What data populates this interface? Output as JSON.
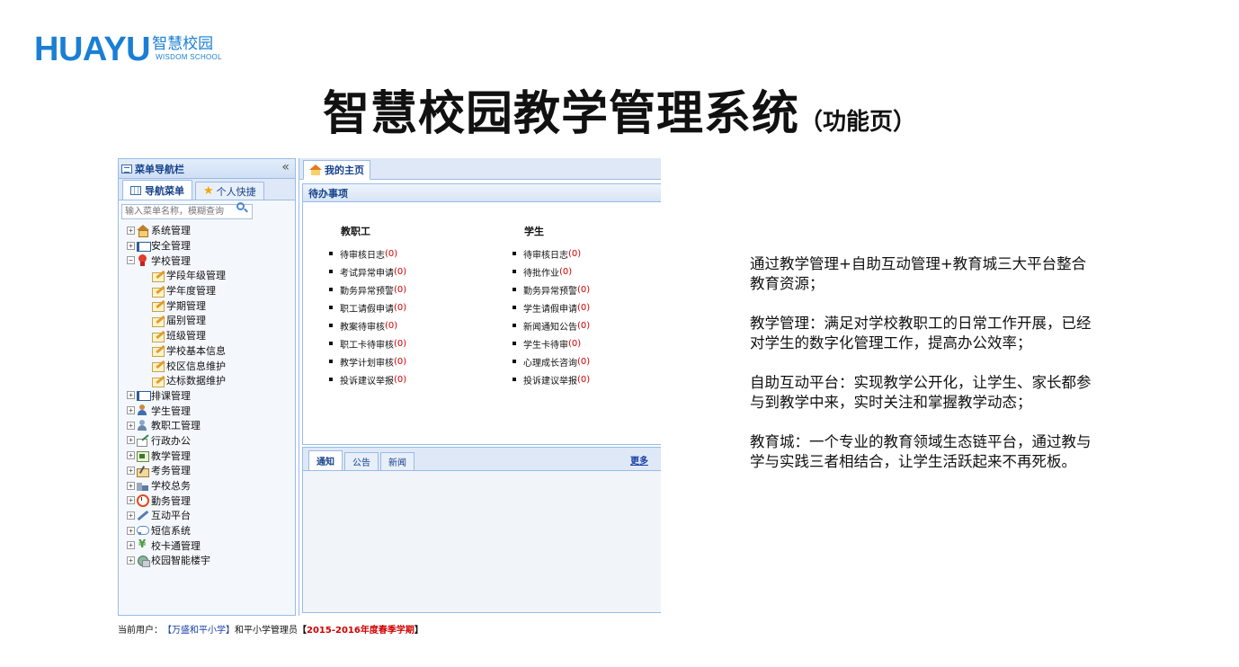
{
  "logo": {
    "word": "HUAYU",
    "cn": "智慧校园",
    "en": "WISDOM SCHOOL"
  },
  "title": {
    "main": "智慧校园教学管理系统",
    "sub": "（功能页）"
  },
  "app": {
    "sidebar": {
      "title": "菜单导航栏",
      "collapse_glyph": "«",
      "tabs": [
        "导航菜单",
        "个人快捷"
      ],
      "search_placeholder": "输入菜单名称，模糊查询",
      "tree": [
        {
          "label": "系统管理",
          "icon": "house-icon",
          "toggle": "+"
        },
        {
          "label": "安全管理",
          "icon": "book-icon",
          "toggle": "+"
        },
        {
          "label": "学校管理",
          "icon": "medal-icon",
          "toggle": "−"
        },
        {
          "label": "学段年级管理",
          "icon": "pencil-icon",
          "child": true
        },
        {
          "label": "学年度管理",
          "icon": "pencil-icon",
          "child": true
        },
        {
          "label": "学期管理",
          "icon": "pencil-icon",
          "child": true
        },
        {
          "label": "届别管理",
          "icon": "pencil-icon",
          "child": true
        },
        {
          "label": "班级管理",
          "icon": "pencil-icon",
          "child": true
        },
        {
          "label": "学校基本信息",
          "icon": "pencil-icon",
          "child": true
        },
        {
          "label": "校区信息维护",
          "icon": "pencil-icon",
          "child": true
        },
        {
          "label": "达标数据维护",
          "icon": "pencil-icon",
          "child": true
        },
        {
          "label": "排课管理",
          "icon": "book-icon",
          "toggle": "+"
        },
        {
          "label": "学生管理",
          "icon": "person-icon",
          "toggle": "+"
        },
        {
          "label": "教职工管理",
          "icon": "staff-icon",
          "toggle": "+"
        },
        {
          "label": "行政办公",
          "icon": "office-icon",
          "toggle": "+"
        },
        {
          "label": "教学管理",
          "icon": "teach-icon",
          "toggle": "+"
        },
        {
          "label": "考务管理",
          "icon": "exam-icon",
          "toggle": "+"
        },
        {
          "label": "学校总务",
          "icon": "bldg-icon",
          "toggle": "+"
        },
        {
          "label": "勤务管理",
          "icon": "clock-icon",
          "toggle": "+"
        },
        {
          "label": "互动平台",
          "icon": "pen-icon",
          "toggle": "+"
        },
        {
          "label": "短信系统",
          "icon": "bubble-icon",
          "toggle": "+"
        },
        {
          "label": "校卡通管理",
          "icon": "yen-icon",
          "toggle": "+"
        },
        {
          "label": "校园智能楼宇",
          "icon": "globe-icon",
          "toggle": "+"
        }
      ]
    },
    "main_tab": "我的主页",
    "todo": {
      "title": "待办事项",
      "staff": {
        "title": "教职工",
        "items": [
          {
            "label": "待审核日志",
            "count": "(0)"
          },
          {
            "label": "考试异常申请",
            "count": "(0)"
          },
          {
            "label": "勤务异常预警",
            "count": "(0)"
          },
          {
            "label": "职工请假申请",
            "count": "(0)"
          },
          {
            "label": "教案待审核",
            "count": "(0)"
          },
          {
            "label": "职工卡待审核",
            "count": "(0)"
          },
          {
            "label": "教学计划审核",
            "count": "(0)"
          },
          {
            "label": "投诉建议举报",
            "count": "(0)"
          }
        ]
      },
      "student": {
        "title": "学生",
        "items": [
          {
            "label": "待审核日志",
            "count": "(0)"
          },
          {
            "label": "待批作业",
            "count": "(0)"
          },
          {
            "label": "勤务异常预警",
            "count": "(0)"
          },
          {
            "label": "学生请假申请",
            "count": "(0)"
          },
          {
            "label": "新闻通知公告",
            "count": "(0)"
          },
          {
            "label": "学生卡待审",
            "count": "(0)"
          },
          {
            "label": "心理成长咨询",
            "count": "(0)"
          },
          {
            "label": "投诉建议举报",
            "count": "(0)"
          }
        ]
      }
    },
    "notice": {
      "tabs": [
        "通知",
        "公告",
        "新闻"
      ],
      "more": "更多"
    },
    "status": {
      "prefix": "当前用户：",
      "school": "【万盛和平小学】",
      "role": " 和平小学管理员 ",
      "term_open": "【",
      "term": "2015-2016年度春季学期",
      "term_close": "】"
    }
  },
  "description": [
    "通过教学管理+自助互动管理+教育城三大平台整合教育资源；",
    "教学管理：满足对学校教职工的日常工作开展，已经对学生的数字化管理工作，提高办公效率；",
    "自助互动平台：实现教学公开化，让学生、家长都参与到教学中来，实时关注和掌握教学动态；",
    "教育城：一个专业的教育领域生态链平台，通过教与学与实践三者相结合，让学生活跃起来不再死板。"
  ]
}
